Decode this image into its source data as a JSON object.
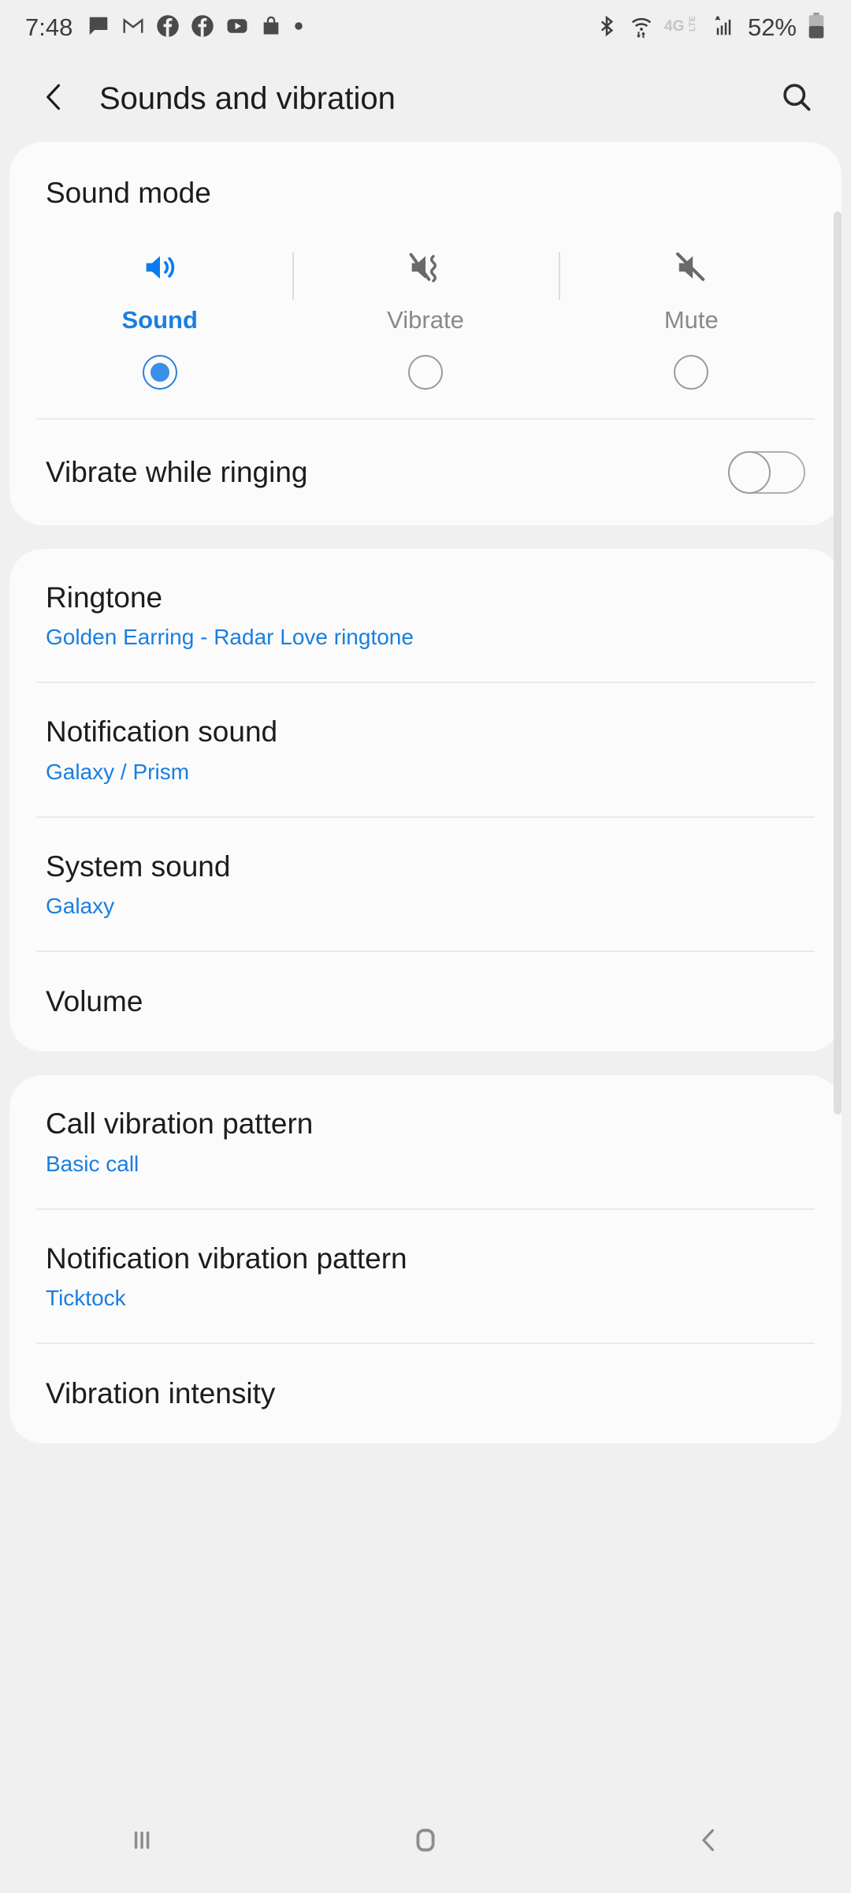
{
  "statusbar": {
    "time": "7:48",
    "notification_icons": [
      "message-icon",
      "gmail-icon",
      "facebook-icon",
      "facebook-icon",
      "youtube-icon",
      "shopping-bag-icon",
      "dot-icon"
    ],
    "bluetooth_icon": "bluetooth-icon",
    "wifi_icon": "wifi-transfer-icon",
    "network_type": "4G LTE",
    "signal_icon": "signal-bars-icon",
    "battery_percent": "52%",
    "battery_icon": "battery-icon"
  },
  "header": {
    "back_icon": "back-chevron-icon",
    "title": "Sounds and vibration",
    "search_icon": "search-icon"
  },
  "sound_mode": {
    "title": "Sound mode",
    "options": [
      {
        "label": "Sound",
        "icon": "speaker-on-icon",
        "selected": true
      },
      {
        "label": "Vibrate",
        "icon": "vibrate-icon",
        "selected": false
      },
      {
        "label": "Mute",
        "icon": "speaker-mute-icon",
        "selected": false
      }
    ],
    "vibrate_while_ringing": {
      "title": "Vibrate while ringing",
      "enabled": false
    }
  },
  "sounds_section": [
    {
      "title": "Ringtone",
      "subtitle": "Golden Earring - Radar Love ringtone"
    },
    {
      "title": "Notification sound",
      "subtitle": "Galaxy / Prism"
    },
    {
      "title": "System sound",
      "subtitle": "Galaxy"
    },
    {
      "title": "Volume",
      "subtitle": ""
    }
  ],
  "vibration_section": [
    {
      "title": "Call vibration pattern",
      "subtitle": "Basic call"
    },
    {
      "title": "Notification vibration pattern",
      "subtitle": "Ticktock"
    },
    {
      "title": "Vibration intensity",
      "subtitle": ""
    }
  ],
  "navbar": {
    "recents_icon": "recents-icon",
    "home_icon": "home-icon",
    "back_icon": "back-chevron-icon"
  },
  "colors": {
    "accent": "#1a7fe0",
    "radio_on": "#3a8fe8",
    "card_bg": "#fbfbfb",
    "page_bg": "#f0f0f0",
    "text": "#1c1c1c",
    "muted": "#8a8a8a"
  }
}
